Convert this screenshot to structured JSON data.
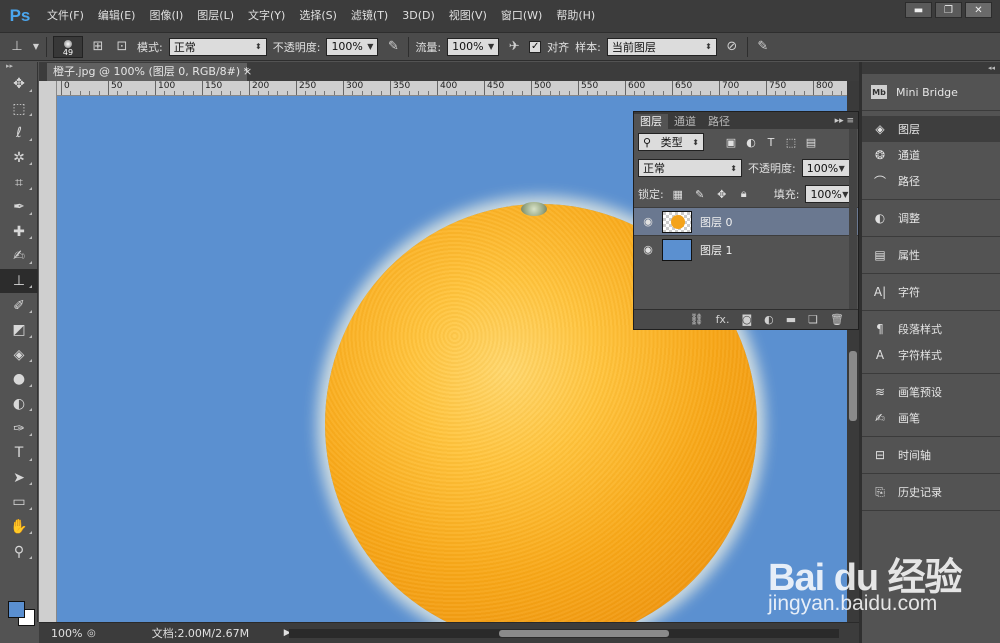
{
  "app": {
    "logo": "Ps"
  },
  "menu": [
    "文件(F)",
    "编辑(E)",
    "图像(I)",
    "图层(L)",
    "文字(Y)",
    "选择(S)",
    "滤镜(T)",
    "3D(D)",
    "视图(V)",
    "窗口(W)",
    "帮助(H)"
  ],
  "window_controls": {
    "minimize": "▬",
    "maximize": "❐",
    "close": "✕"
  },
  "options": {
    "brush_size": "49",
    "mode_label": "模式:",
    "mode_value": "正常",
    "opacity_label": "不透明度:",
    "opacity_value": "100%",
    "flow_label": "流量:",
    "flow_value": "100%",
    "align_label": "对齐",
    "align_checked": "✓",
    "sample_label": "样本:",
    "sample_value": "当前图层"
  },
  "document": {
    "tab_title": "橙子.jpg @ 100% (图层 0, RGB/8#) *",
    "close": "×",
    "ruler_labels": [
      "0",
      "50",
      "100",
      "150",
      "200",
      "250",
      "300",
      "350",
      "400",
      "450",
      "500",
      "550",
      "600",
      "650",
      "700",
      "750",
      "800"
    ]
  },
  "status": {
    "zoom": "100%",
    "doc_info": "文档:2.00M/2.67M",
    "arrow": "▶"
  },
  "layers_panel": {
    "tabs": [
      "图层",
      "通道",
      "路径"
    ],
    "menu_icon": "▸▸ ≡",
    "filter_type": "类型",
    "blend_mode": "正常",
    "opacity_label": "不透明度:",
    "opacity_value": "100%",
    "lock_label": "锁定:",
    "fill_label": "填充:",
    "fill_value": "100%",
    "layers": [
      {
        "name": "图层 0",
        "selected": true
      },
      {
        "name": "图层 1",
        "selected": false
      }
    ],
    "bottom_icons": [
      "link-icon",
      "fx-icon",
      "mask-icon",
      "adjustment-icon",
      "folder-icon",
      "new-layer-icon",
      "trash-icon"
    ],
    "fx_text": "fx."
  },
  "dock": {
    "groups": [
      [
        {
          "label": "Mini Bridge",
          "icon": "mini-bridge-icon"
        }
      ],
      [
        {
          "label": "图层",
          "icon": "layers-icon",
          "active": true
        },
        {
          "label": "通道",
          "icon": "channels-icon"
        },
        {
          "label": "路径",
          "icon": "paths-icon"
        }
      ],
      [
        {
          "label": "调整",
          "icon": "adjustments-icon"
        }
      ],
      [
        {
          "label": "属性",
          "icon": "properties-icon"
        }
      ],
      [
        {
          "label": "字符",
          "icon": "character-icon"
        }
      ],
      [
        {
          "label": "段落样式",
          "icon": "paragraph-styles-icon"
        },
        {
          "label": "字符样式",
          "icon": "character-styles-icon"
        }
      ],
      [
        {
          "label": "画笔预设",
          "icon": "brush-presets-icon"
        },
        {
          "label": "画笔",
          "icon": "brush-icon"
        }
      ],
      [
        {
          "label": "时间轴",
          "icon": "timeline-icon"
        }
      ],
      [
        {
          "label": "历史记录",
          "icon": "history-icon"
        }
      ]
    ]
  },
  "colors": {
    "foreground": "#5a8fd0",
    "background": "#ffffff",
    "canvas_bg": "#5b90d0"
  },
  "watermark": {
    "main": "Bai du 经验",
    "sub": "jingyan.baidu.com"
  }
}
